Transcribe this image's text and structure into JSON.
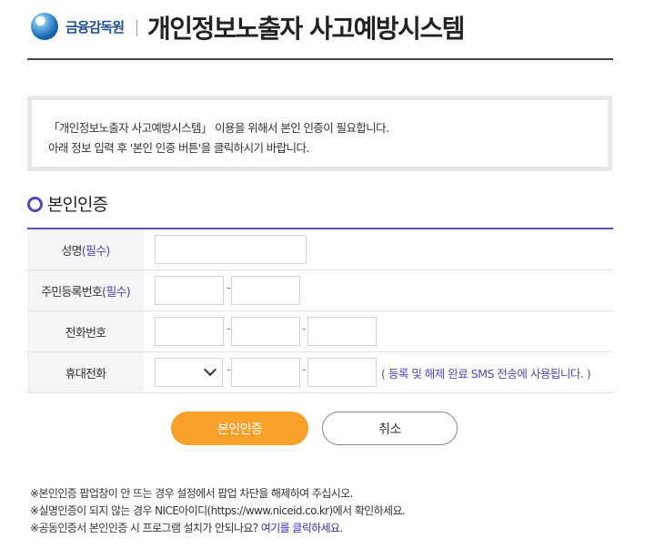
{
  "header": {
    "org_name": "금융감독원",
    "title": "개인정보노출자 사고예방시스템"
  },
  "notice": {
    "line1": "「개인정보노출자 사고예방시스템」 이용을 위해서 본인 인증이 필요합니다.",
    "line2": "아래 정보 입력 후 '본인 인증 버튼'을 클릭하시기 바랍니다."
  },
  "section": {
    "title": "본인인증"
  },
  "form": {
    "name_label": "성명",
    "name_required": "(필수)",
    "rrn_label": "주민등록번호",
    "rrn_required": "(필수)",
    "phone_label": "전화번호",
    "mobile_label": "휴대전화",
    "dash": "-",
    "sms_note": "( 등록 및 해제 완료 SMS 전송에 사용됩니다. )",
    "name_value": "",
    "rrn_front": "",
    "rrn_back": "",
    "phone_1": "",
    "phone_2": "",
    "phone_3": "",
    "mobile_prefix": "",
    "mobile_2": "",
    "mobile_3": ""
  },
  "buttons": {
    "confirm": "본인인증",
    "cancel": "취소"
  },
  "footnotes": {
    "note1": "※본인인증 팝업창이 안 뜨는 경우 설정에서 팝업 차단을 해제하여 주십시오.",
    "note2": "※실명인증이 되지 않는 경우 NICE아이디(https://www.niceid.co.kr)에서 확인하세요.",
    "note3_prefix": "※공동인증서 본인인증 시 프로그램 설치가 안되나요? ",
    "note3_link": "여기를 클릭하세요."
  },
  "colors": {
    "accent_purple": "#5546b8",
    "confirm_orange": "#f9a02b",
    "logo_blue": "#1e6fb8"
  },
  "icons": {
    "logo": "fss-globe-icon",
    "section_marker": "ring-icon",
    "dropdown": "chevron-down-icon"
  }
}
